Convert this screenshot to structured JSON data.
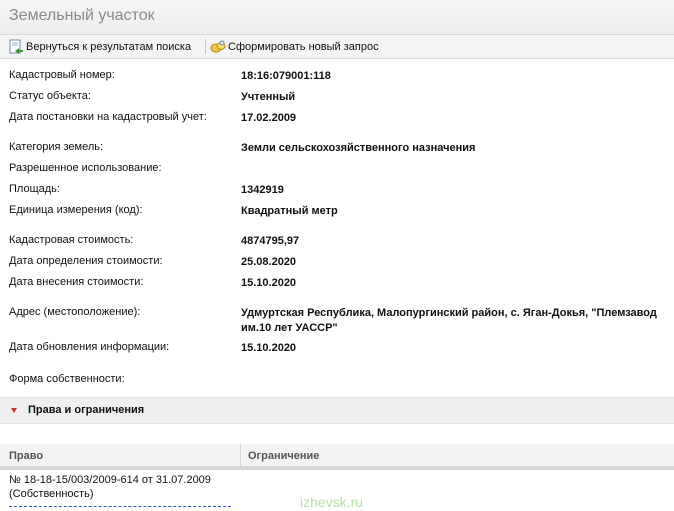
{
  "window": {
    "title": "Земельный участок"
  },
  "toolbar": {
    "back_label": "Вернуться к результатам поиска",
    "new_query_label": "Сформировать новый запрос"
  },
  "fields": [
    {
      "label": "Кадастровый номер:",
      "value": "18:16:079001:118"
    },
    {
      "label": "Статус объекта:",
      "value": "Учтенный"
    },
    {
      "label": "Дата постановки на кадастровый учет:",
      "value": "17.02.2009"
    },
    {
      "label": "Категория земель:",
      "value": "Земли сельскохозяйственного назначения"
    },
    {
      "label": "Разрешенное использование:",
      "value": ""
    },
    {
      "label": "Площадь:",
      "value": "1342919"
    },
    {
      "label": "Единица измерения (код):",
      "value": "Квадратный метр"
    },
    {
      "label": "Кадастровая стоимость:",
      "value": "4874795,97"
    },
    {
      "label": "Дата определения стоимости:",
      "value": "25.08.2020"
    },
    {
      "label": "Дата внесения стоимости:",
      "value": "15.10.2020"
    },
    {
      "label": "Адрес (местоположение):",
      "value": "Удмуртская Республика, Малопургинский район, с. Яган-Докья, \"Племзавод им.10 лет УАССР\""
    },
    {
      "label": "Дата обновления информации:",
      "value": "15.10.2020"
    },
    {
      "label": "Форма собственности:",
      "value": ""
    }
  ],
  "rights_section": {
    "title": "Права и ограничения",
    "columns": [
      "Право",
      "Ограничение"
    ],
    "rows": [
      {
        "right": "№ 18-18-15/003/2009-614  от 31.07.2009 (Собственность)",
        "restriction": ""
      }
    ]
  },
  "watermark": "izhevsk.ru",
  "colors": {
    "section_arrow": "#c0392b",
    "watermark": "#b8dfa4"
  }
}
